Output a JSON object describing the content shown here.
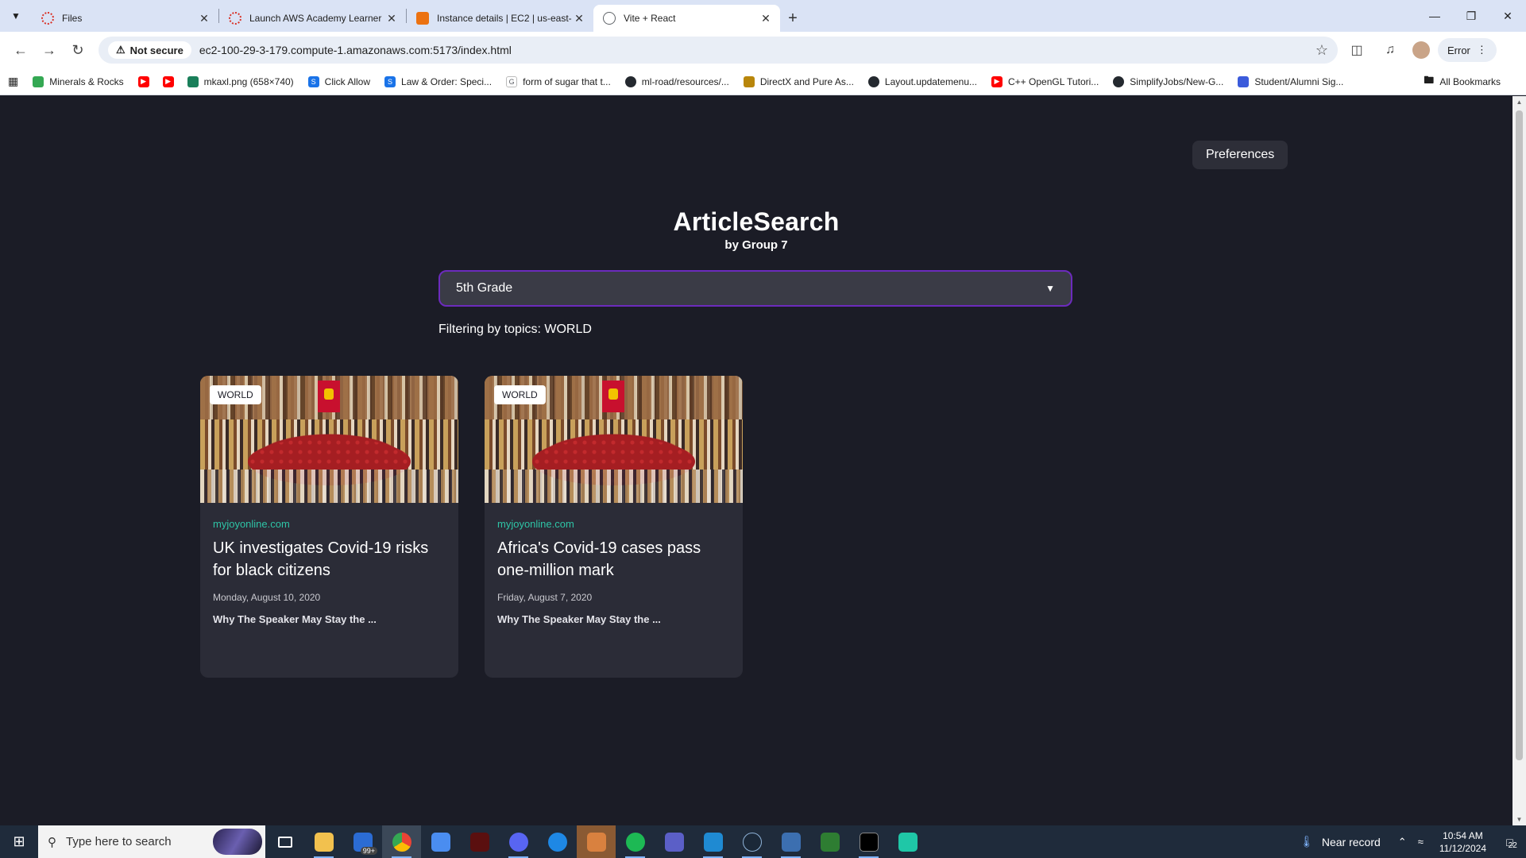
{
  "browser": {
    "tabs": [
      {
        "title": "Files",
        "fav_color": "#d93025",
        "active": false
      },
      {
        "title": "Launch AWS Academy Learner",
        "fav_color": "#d93025",
        "active": false
      },
      {
        "title": "Instance details | EC2 | us-east-",
        "fav_color": "#ec7211",
        "active": false
      },
      {
        "title": "Vite + React",
        "fav_color": "#5f6368",
        "active": true
      }
    ],
    "security_chip": "Not secure",
    "url": "ec2-100-29-3-179.compute-1.amazonaws.com:5173/index.html",
    "profile_status": "Error",
    "bookmarks": [
      {
        "label": "Minerals & Rocks",
        "color": "#34a853"
      },
      {
        "label": "",
        "color": "#ff0000"
      },
      {
        "label": "",
        "color": "#ff0000"
      },
      {
        "label": "mkaxl.png (658×740)",
        "color": "#1a7f5a"
      },
      {
        "label": "Click Allow",
        "color": "#1a73e8"
      },
      {
        "label": "Law & Order: Speci...",
        "color": "#1a73e8"
      },
      {
        "label": "form of sugar that t...",
        "color": "#5f6368"
      },
      {
        "label": "ml-road/resources/...",
        "color": "#24292f"
      },
      {
        "label": "DirectX and Pure As...",
        "color": "#b8860b"
      },
      {
        "label": "Layout.updatemenu...",
        "color": "#24292f"
      },
      {
        "label": "C++ OpenGL Tutori...",
        "color": "#ff0000"
      },
      {
        "label": "SimplifyJobs/New-G...",
        "color": "#24292f"
      },
      {
        "label": "Student/Alumni Sig...",
        "color": "#3b5bdb"
      }
    ],
    "all_bookmarks": "All Bookmarks"
  },
  "page": {
    "preferences_label": "Preferences",
    "title": "ArticleSearch",
    "subtitle": "by Group 7",
    "grade_selected": "5th Grade",
    "filter_text": "Filtering by topics: WORLD",
    "articles": [
      {
        "badge": "WORLD",
        "source": "myjoyonline.com",
        "headline": "UK investigates Covid-19 risks for black citizens",
        "date": "Monday, August 10, 2020",
        "snippet": "Why The Speaker May Stay the ..."
      },
      {
        "badge": "WORLD",
        "source": "myjoyonline.com",
        "headline": "Africa's Covid-19 cases pass one-million mark",
        "date": "Friday, August 7, 2020",
        "snippet": "Why The Speaker May Stay the ..."
      }
    ]
  },
  "taskbar": {
    "search_placeholder": "Type here to search",
    "mail_badge": "99+",
    "weather": "Near record",
    "time": "10:54 AM",
    "date": "11/12/2024",
    "notification_count": "22"
  }
}
